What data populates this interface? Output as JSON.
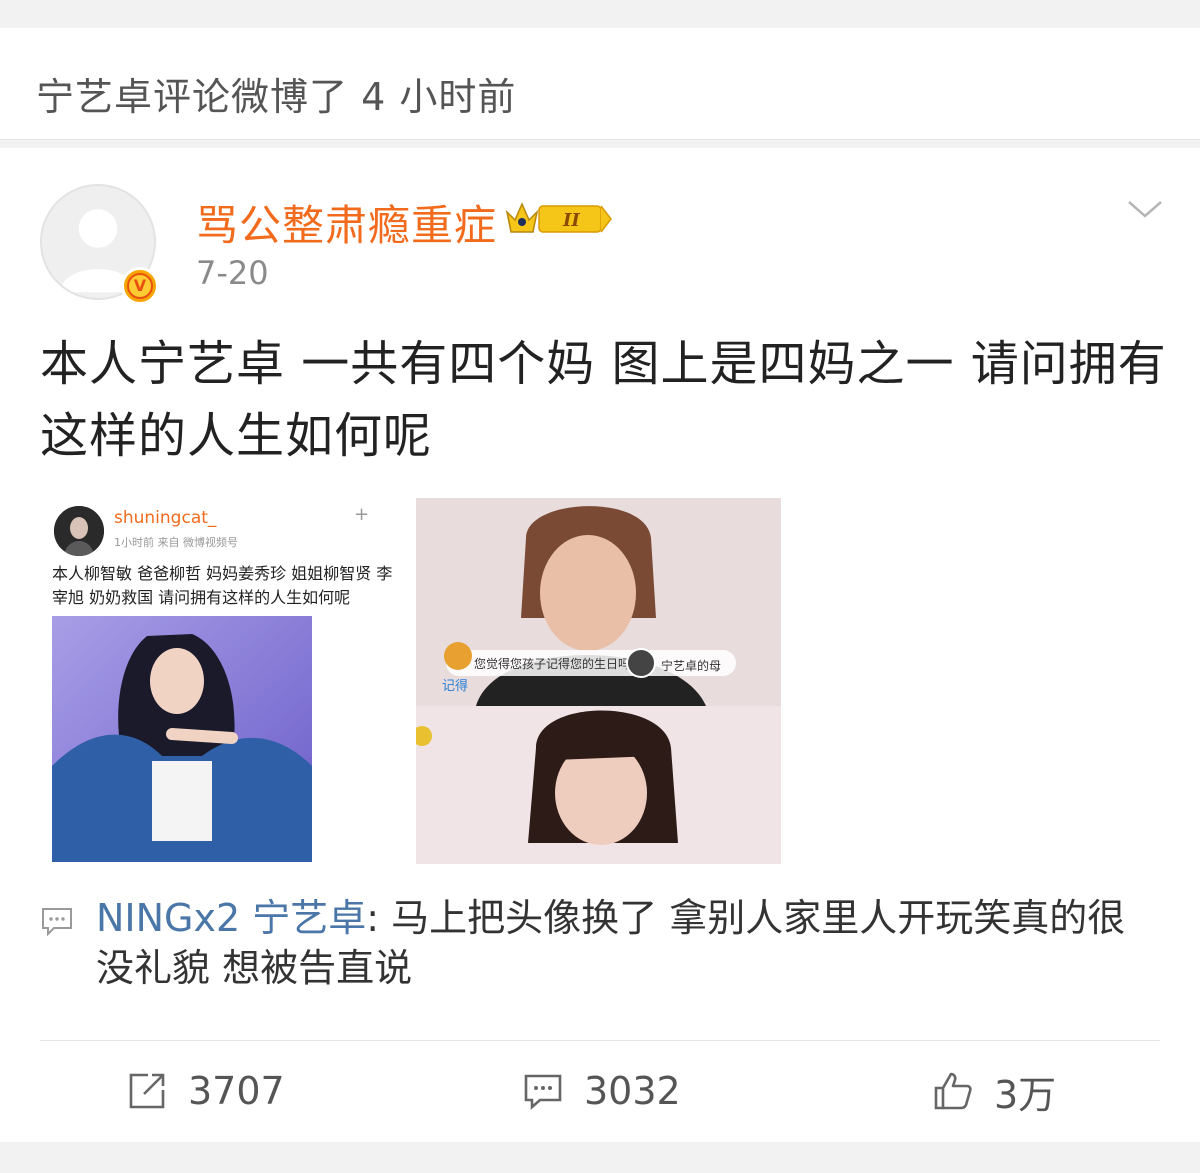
{
  "header": {
    "activity_text": "宁艺卓评论微博了 4 小时前"
  },
  "post": {
    "author_name": "骂公整肃瘾重症",
    "vip_level": "II",
    "time": "7-20",
    "content": "本人宁艺卓 一共有四个妈 图上是四妈之一 请问拥有这样的人生如何呢",
    "image1": {
      "username": "shuningcat_",
      "meta": "1小时前 来自 微博视频号",
      "caption": "本人柳智敏 爸爸柳哲 妈妈姜秀珍 姐姐柳智贤 李宰旭 奶奶救国 请问拥有这样的人生如何呢"
    },
    "image2": {
      "subtitle": "您觉得您孩子记得您的生日吗?",
      "tag": "宁艺卓的母",
      "label": "记得"
    }
  },
  "comment": {
    "author": "NINGx2 宁艺卓",
    "separator": ": ",
    "text": "马上把头像换了 拿别人家里人开玩笑真的很没礼貌 想被告直说"
  },
  "actions": {
    "reposts": "3707",
    "comments": "3032",
    "likes": "3万"
  },
  "colors": {
    "username": "#f26b1d",
    "comment_author": "#4a76a8",
    "vip_gold": "#f5c518"
  }
}
